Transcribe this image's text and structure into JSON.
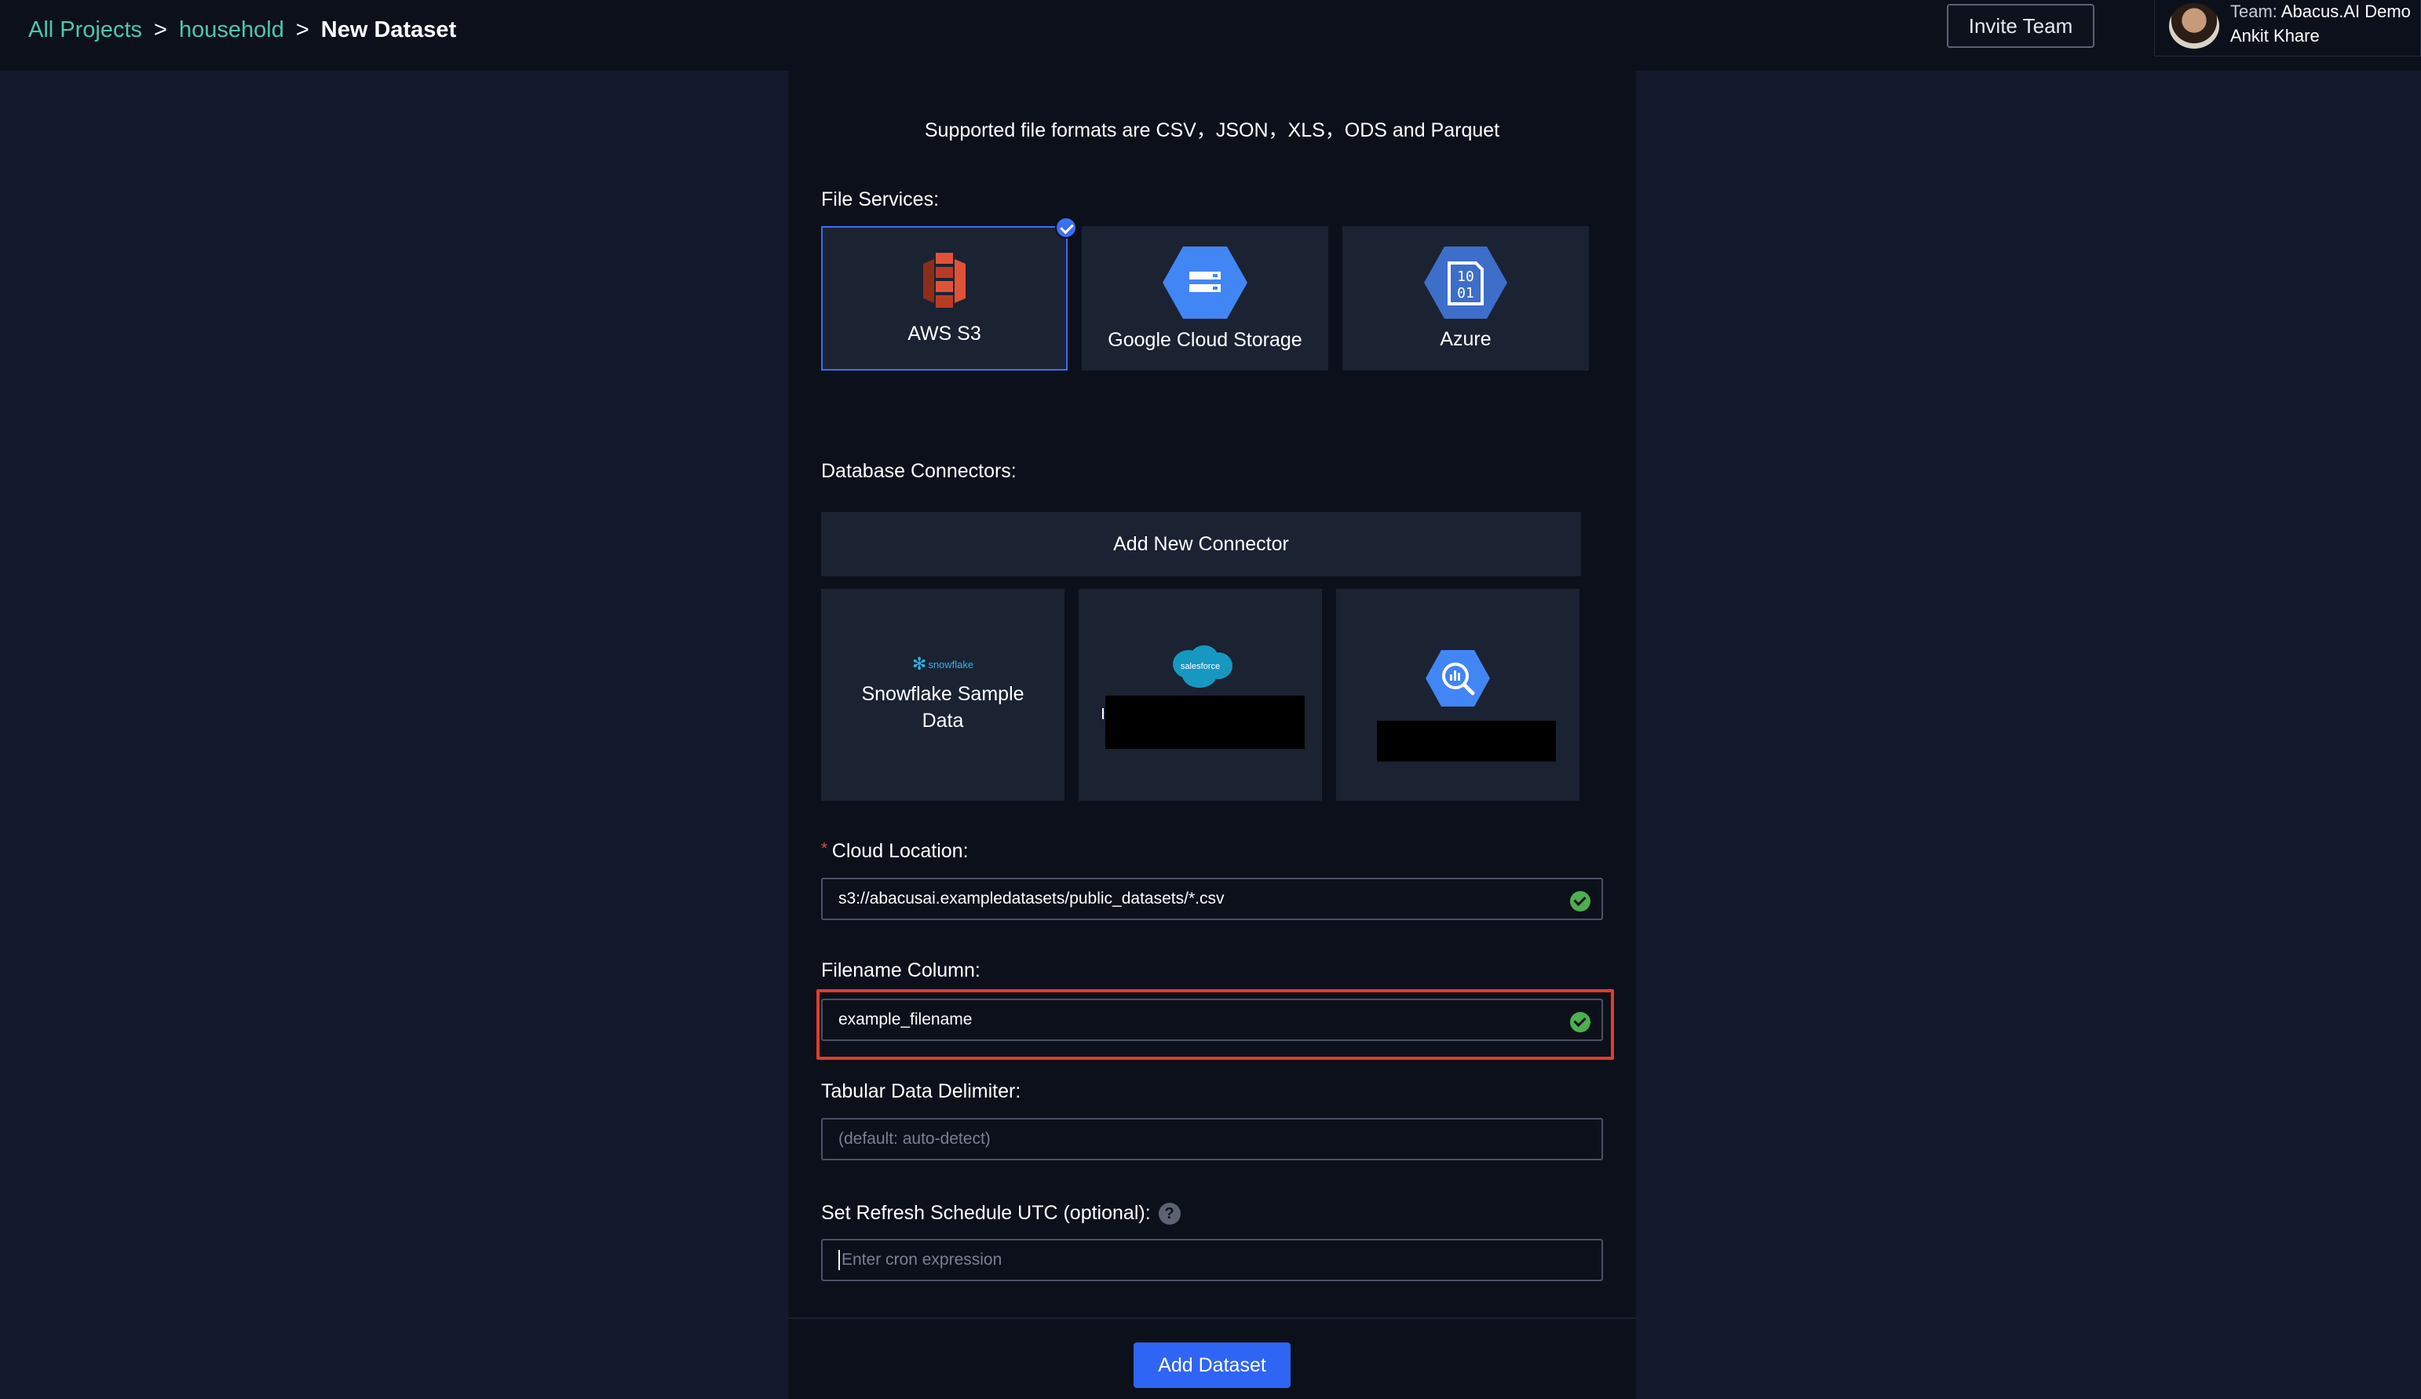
{
  "breadcrumb": {
    "root": "All Projects",
    "project": "household",
    "separator": ">",
    "current": "New Dataset"
  },
  "header": {
    "invite_label": "Invite Team",
    "team_prefix": "Team:",
    "team_name": "Abacus.AI Demo",
    "user_name": "Ankit Khare"
  },
  "form": {
    "formats_note": "Supported file formats are CSV，JSON，XLS，ODS and Parquet",
    "file_services_label": "File Services:",
    "file_services": [
      {
        "label": "AWS S3",
        "icon": "aws-s3-icon",
        "selected": true
      },
      {
        "label": "Google Cloud Storage",
        "icon": "google-cloud-storage-icon",
        "selected": false
      },
      {
        "label": "Azure",
        "icon": "azure-icon",
        "selected": false
      }
    ],
    "database_connectors_label": "Database Connectors:",
    "add_connector_label": "Add New Connector",
    "connectors": [
      {
        "label": "Snowflake Sample Data",
        "logo_text": "snowflake",
        "icon": "snowflake-icon"
      },
      {
        "label": "",
        "logo_text": "salesforce",
        "icon": "salesforce-icon"
      },
      {
        "label": "",
        "logo_text": "",
        "icon": "bigquery-icon"
      }
    ],
    "cloud_location": {
      "required_mark": "*",
      "label": "Cloud Location:",
      "value": "s3://abacusai.exampledatasets/public_datasets/*.csv"
    },
    "filename_column": {
      "label": "Filename Column:",
      "value": "example_filename"
    },
    "delimiter": {
      "label": "Tabular Data Delimiter:",
      "placeholder": "(default: auto-detect)"
    },
    "refresh": {
      "label": "Set Refresh Schedule UTC (optional):",
      "help": "?",
      "placeholder": "Enter cron expression"
    },
    "submit_label": "Add Dataset"
  },
  "colors": {
    "accent_link": "#4cc9a7",
    "primary_button": "#2f65f5",
    "selected_border": "#3b6ef5",
    "valid_check": "#4caf50",
    "highlight": "#e23b2a"
  }
}
